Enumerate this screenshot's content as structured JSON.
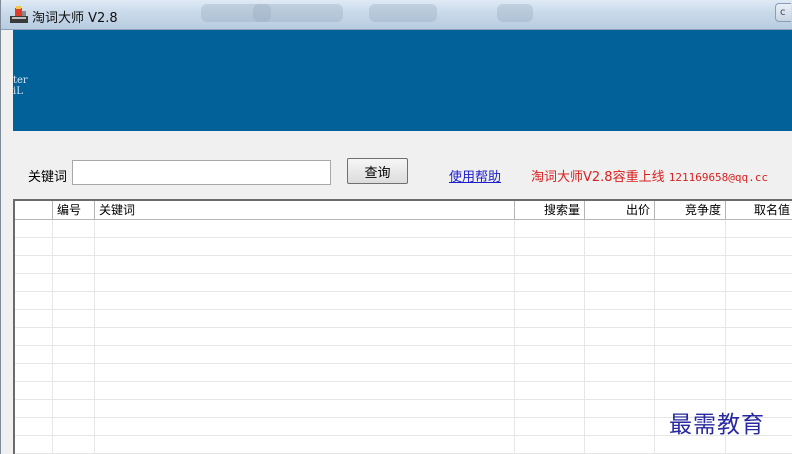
{
  "window": {
    "title": "淘词大师 V2.8",
    "control_glyph": "c"
  },
  "banner": {
    "fragment_line1": "ter",
    "fragment_line2": "iL",
    "color": "#03619a"
  },
  "search": {
    "label": "关键词",
    "value": "",
    "placeholder": "",
    "button_label": "查询",
    "help_link": "使用帮助",
    "promo_text": "淘词大师V2.8容重上线 ",
    "promo_email": "121169658@qq.cc",
    "promo_color": "#d82020"
  },
  "table": {
    "columns": [
      "",
      "编号",
      "关键词",
      "搜索量",
      "出价",
      "竞争度",
      "取名值"
    ],
    "rows": []
  },
  "watermark": "最需教育",
  "icons": {
    "app": "app-logo-icon"
  }
}
